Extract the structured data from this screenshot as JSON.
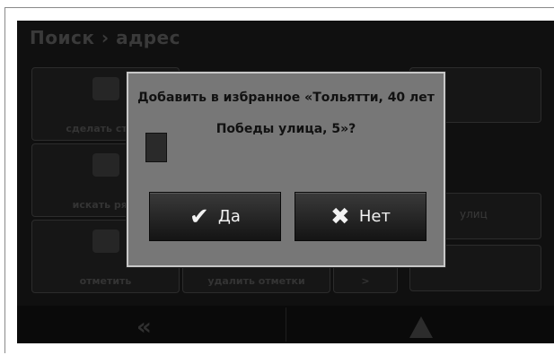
{
  "background_title": "Поиск › адрес",
  "tiles": [
    {
      "label": "сделать ста..."
    },
    {
      "label": "искать ря..."
    },
    {
      "label": "отметить"
    },
    {
      "label": "удалить отметки"
    },
    {
      "label": ">"
    }
  ],
  "right_label": "улиц",
  "bottom_bar": {
    "back_icon": "«"
  },
  "dialog": {
    "message": "Добавить в избранное «Тольятти, 40 лет Победы улица, 5»?",
    "yes_label": "Да",
    "no_label": "Нет",
    "yes_icon": "✔",
    "no_icon": "✖"
  },
  "colors": {
    "screen_bg": "#101010",
    "dialog_bg": "#777777",
    "button_bg": "#1c1c1c"
  }
}
